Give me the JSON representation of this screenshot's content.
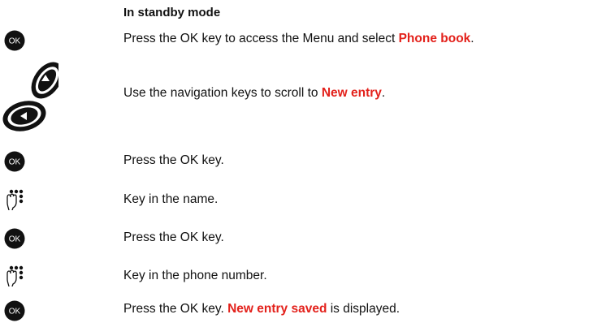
{
  "heading": "In standby mode",
  "steps": [
    {
      "icon": "ok-key-icon",
      "parts": [
        "Press the OK key to access the Menu and select ",
        "Phone book",
        "."
      ]
    },
    {
      "icon": "navigation-keys-icon",
      "parts": [
        "Use the navigation keys to scroll to ",
        "New entry",
        "."
      ]
    },
    {
      "icon": "ok-key-icon",
      "parts": [
        "Press the OK key."
      ]
    },
    {
      "icon": "keypad-icon",
      "parts": [
        "Key in the name."
      ]
    },
    {
      "icon": "ok-key-icon",
      "parts": [
        "Press the OK key."
      ]
    },
    {
      "icon": "keypad-icon",
      "parts": [
        "Key in the phone number."
      ]
    },
    {
      "icon": "ok-key-icon",
      "parts": [
        "Press the OK key. ",
        "New entry saved",
        " is displayed."
      ]
    }
  ],
  "ok_key_label": "OK",
  "colors": {
    "highlight": "#e3211b",
    "icon": "#111111"
  }
}
